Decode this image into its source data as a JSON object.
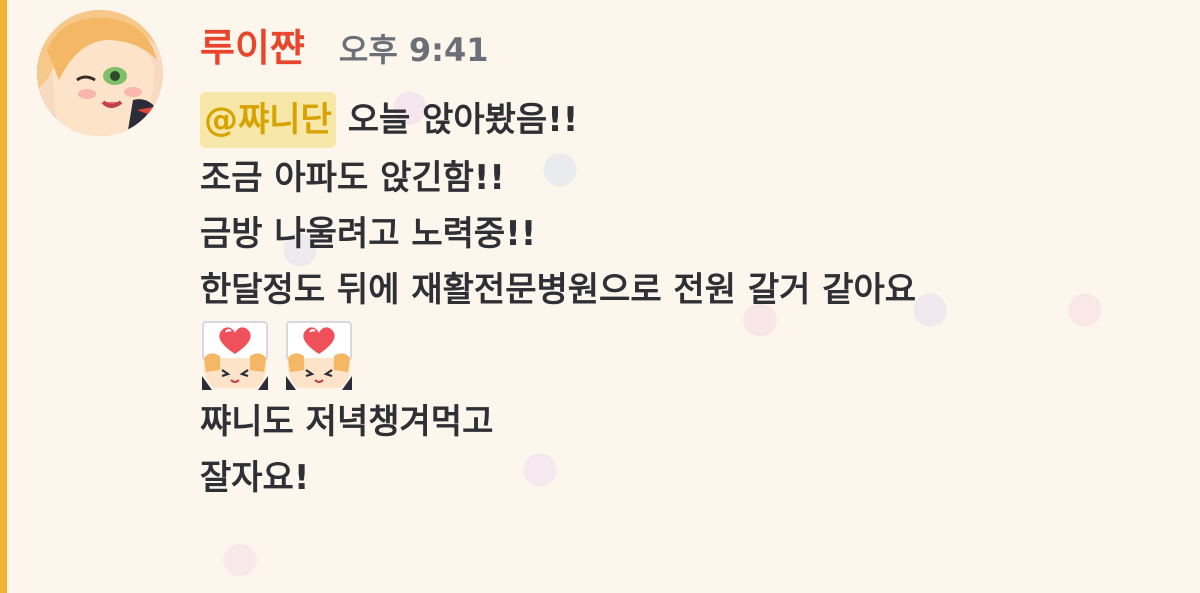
{
  "message": {
    "author": "루이쨘",
    "timestamp": "오후 9:41",
    "mention": "@쨔니단",
    "lines": [
      "오늘 앉아봤음!!",
      "조금 아파도 앉긴함!!",
      "금방 나울려고 노력중!!",
      "한달정도 뒤에 재활전문병원으로 전원 갈거 같아요",
      "쨔니도 저녁챙겨먹고",
      "잘자요!"
    ],
    "stickers": [
      "heart-sign-sticker",
      "heart-sign-sticker"
    ],
    "avatar_icon": "avatar-anime-character",
    "colors": {
      "background": "#fdf6ec",
      "highlight_bar": "#f0b232",
      "username": "#e8452c",
      "mention_text": "#d8a200",
      "mention_background": "#f7e7a8",
      "text": "#2e3036",
      "timestamp": "#6b7078"
    }
  }
}
